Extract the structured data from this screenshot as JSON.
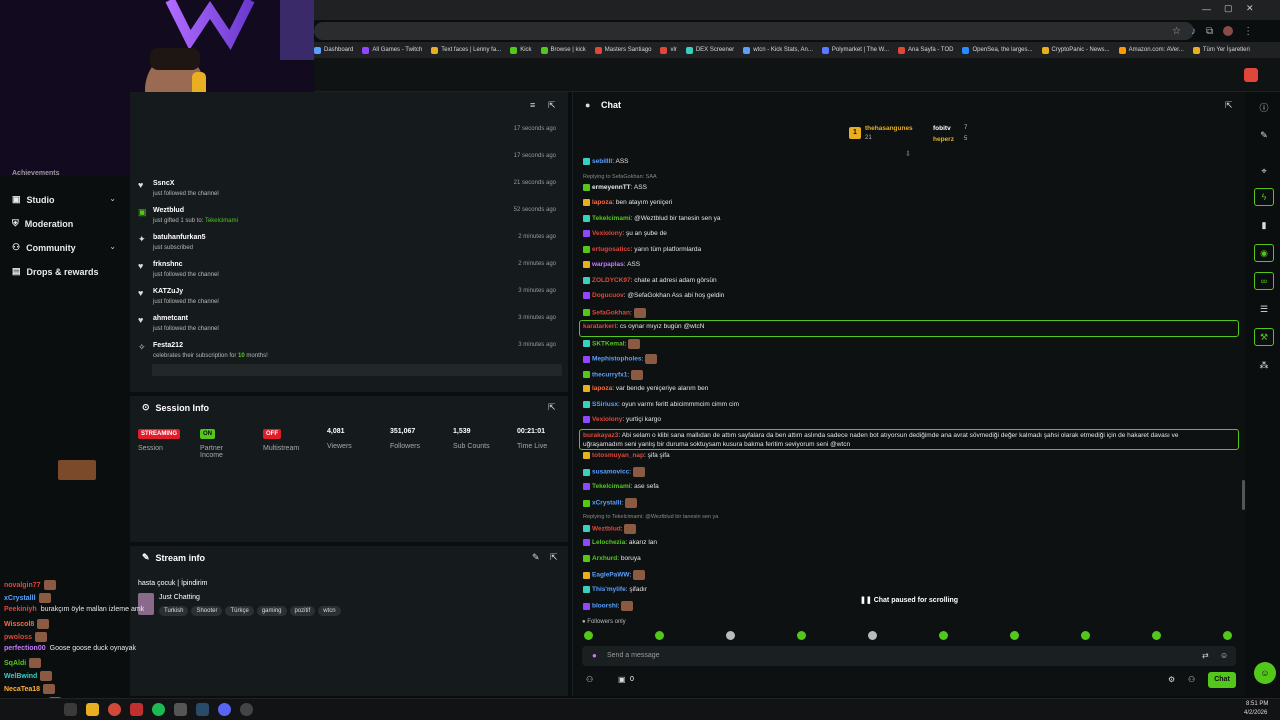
{
  "bookmarks": [
    "Dashboard",
    "All Games - Twitch",
    "Text faces | Lenny fa...",
    "Kick",
    "Browse | kick",
    "Masters Santiago",
    "vlr",
    "DEX Screener",
    "wtcn - Kick Stats, An...",
    "Polymarket | The W...",
    "Ana Sayfa - TOD",
    "OpenSea, the larges...",
    "CryptoPanic - News...",
    "Amazon.com: AVer...",
    "Tüm Yer İşaretleri"
  ],
  "sidebar": {
    "partial_item": "Achievements",
    "items": [
      {
        "label": "Studio",
        "icon": "video-icon",
        "chevron": true
      },
      {
        "label": "Moderation",
        "icon": "shield-icon",
        "chevron": false
      },
      {
        "label": "Community",
        "icon": "people-icon",
        "chevron": true
      },
      {
        "label": "Drops & rewards",
        "icon": "gift-icon",
        "chevron": false
      }
    ]
  },
  "feed": {
    "rows": [
      {
        "name": "",
        "sub": "",
        "time": "17 seconds ago"
      },
      {
        "name": "",
        "sub": "",
        "time": "17 seconds ago"
      },
      {
        "name": "SsncX",
        "sub": "just followed the channel",
        "time": "21 seconds ago",
        "icon": "heart"
      },
      {
        "name": "Weztblud",
        "sub": "just gifted 1 sub to:",
        "target": "Tekelcimami",
        "time": "52 seconds ago",
        "icon": "gift"
      },
      {
        "name": "batuhanfurkan5",
        "sub": "just subscribed",
        "time": "2 minutes ago",
        "icon": "star"
      },
      {
        "name": "frknshnc",
        "sub": "just followed the channel",
        "time": "2 minutes ago",
        "icon": "heart"
      },
      {
        "name": "KATZuJy",
        "sub": "just followed the channel",
        "time": "3 minutes ago",
        "icon": "heart"
      },
      {
        "name": "ahmetcant",
        "sub": "just followed the channel",
        "time": "3 minutes ago",
        "icon": "heart"
      },
      {
        "name": "Festa212",
        "sub": "celebrates their subscription for",
        "months": "10",
        "months_suffix": "months!",
        "time": "3 minutes ago",
        "icon": "party"
      }
    ]
  },
  "session": {
    "title": "Session Info",
    "badges": [
      {
        "text": "STREAMING",
        "label": "Session",
        "color": "#e11d2a"
      },
      {
        "text": "ON",
        "label": "Partner Income",
        "color": "#53c81a"
      },
      {
        "text": "OFF",
        "label": "Multistream",
        "color": "#e11d2a"
      }
    ],
    "stats": [
      {
        "value": "4,081",
        "label": "Viewers"
      },
      {
        "value": "351,067",
        "label": "Followers"
      },
      {
        "value": "1,539",
        "label": "Sub Counts"
      },
      {
        "value": "00:21:01",
        "label": "Time Live"
      }
    ]
  },
  "stream_info": {
    "title": "Stream info",
    "stream_title": "hasta çocuk | İpindirim",
    "category": "Just Chatting",
    "tags": [
      "Turkish",
      "Shooter",
      "Türkçe",
      "gaming",
      "pozitif",
      "wtcn"
    ]
  },
  "overlay_chat": [
    {
      "user": "novalgin77",
      "text": "",
      "color": "#e0473a"
    },
    {
      "user": "xCrystalll",
      "text": "",
      "color": "#5aa0ff"
    },
    {
      "user": "Peekiniyh",
      "text": "burakçım öyle mallan izleme amk",
      "color": "#e0473a"
    },
    {
      "user": "Wisscol8",
      "text": "",
      "color": "#ff6a3a"
    },
    {
      "user": "pwoloss",
      "text": "",
      "color": "#e0473a"
    },
    {
      "user": "perfection00",
      "text": "Goose goose duck oynayak",
      "color": "#c87aff"
    },
    {
      "user": "SqAldi",
      "text": "",
      "color": "#53c81a"
    },
    {
      "user": "WelBwind",
      "text": "",
      "color": "#3ad0c0"
    },
    {
      "user": "NecaTea18",
      "text": "",
      "color": "#ffb23a"
    },
    {
      "user": "Tekelcimami",
      "text": "",
      "color": "#53c81a"
    }
  ],
  "chat": {
    "title": "Chat",
    "top_gifters": [
      {
        "rank": "1",
        "name": "thehasangunes",
        "count": "21"
      },
      {
        "rank": "",
        "name": "fobitv",
        "count": "7"
      },
      {
        "rank": "",
        "name": "heperz",
        "count": "5"
      }
    ],
    "messages": [
      {
        "user": "sebillll",
        "text": "ASS",
        "color": "#5aa0ff"
      },
      {
        "reply": "Replying to SefaGokhan: SAA"
      },
      {
        "user": "ermeyennTT",
        "text": "ASS",
        "color": "#e8e8e8"
      },
      {
        "user": "lapoza",
        "text": "ben atayım yeniçeri",
        "color": "#ff6a3a"
      },
      {
        "user": "Tekelcimami",
        "text": "@Weztblud bir tanesin sen ya",
        "color": "#53c81a"
      },
      {
        "user": "Vexiolony",
        "text": "şu an şube de",
        "color": "#e0473a"
      },
      {
        "user": "ertugosaticc",
        "text": "yarın tüm platformlarda",
        "color": "#e0473a"
      },
      {
        "user": "warpaplas",
        "text": "ASS",
        "color": "#c87aff"
      },
      {
        "user": "ZOLDYCK97",
        "text": "chate at adresi adam görsün",
        "color": "#e0473a"
      },
      {
        "user": "Dogucuov",
        "text": "@SefaGokhan Ass abi hoş geldin",
        "color": "#e0473a"
      },
      {
        "user": "SefaGokhan",
        "text": "",
        "color": "#e0473a"
      },
      {
        "user": "karatarkeri",
        "text": "cs oynar mıyız bugün @wtcN",
        "color": "#e0473a",
        "highlight": true
      },
      {
        "user": "SKTKemal",
        "text": "",
        "color": "#53c81a"
      },
      {
        "user": "Mephistopholes",
        "text": "",
        "color": "#5aa0ff"
      },
      {
        "user": "thecurryfx1",
        "text": "",
        "color": "#5aa0ff"
      },
      {
        "user": "lapoza",
        "text": "var bende yeniçeriye alarım ben",
        "color": "#ff6a3a"
      },
      {
        "user": "SSiriusx",
        "text": "oyun varmı feritt abicimmmcim cimm cim",
        "color": "#5aa0ff"
      },
      {
        "user": "Vexiolony",
        "text": "yurtiçi kargo",
        "color": "#e0473a"
      },
      {
        "user": "burakayaz3",
        "text": "Abi selam o klibi sana mallıdan de attım sayfalara da ben attım aslında sadece naden bot atıyorsun dediğimde ana avrat sövmediği değer kalmadı şahsi olarak etmediği için de hakaret davası ve",
        "text2": "uğraşamadım seni yanlış bir duruma soktuysam kusura bakma feritim seviyorum seni @wtcn",
        "color": "#e0473a",
        "highlight": true
      },
      {
        "user": "totosmuyan_nap",
        "text": "şifa şifa",
        "color": "#e0473a"
      },
      {
        "user": "susamovicc",
        "text": "",
        "color": "#5aa0ff"
      },
      {
        "user": "Tekelcimami",
        "text": "ase sefa",
        "color": "#53c81a"
      },
      {
        "user": "xCrystalli",
        "text": "",
        "color": "#5aa0ff"
      },
      {
        "reply": "Replying to Tekelcimami: @Weztblud bir tanesin sen ya"
      },
      {
        "user": "Weztblud",
        "text": "",
        "color": "#e0473a"
      },
      {
        "user": "Lelochezia",
        "text": "akarız lan",
        "color": "#53c81a"
      },
      {
        "user": "Arxhurd",
        "text": "boruya",
        "color": "#53c81a"
      },
      {
        "user": "EaglePaWW",
        "text": "",
        "color": "#5aa0ff"
      },
      {
        "user": "This'mylife",
        "text": "şifadır",
        "color": "#5aa0ff"
      },
      {
        "user": "bloorshi",
        "text": "",
        "color": "#5aa0ff"
      }
    ],
    "paused_text": "Chat paused for scrolling",
    "followers_only": "Followers only",
    "send_placeholder": "Send a message",
    "points": "0",
    "chat_button": "Chat"
  },
  "taskbar": {
    "time": "8:51 PM",
    "date": "4/2/2026"
  },
  "colors": {
    "accent": "#53c81a",
    "live_red": "#e11d2a",
    "panel": "#151a1c"
  }
}
